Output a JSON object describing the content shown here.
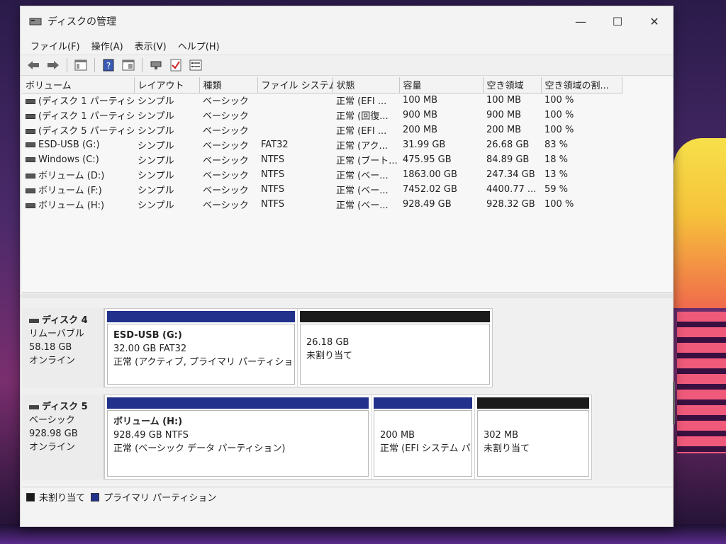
{
  "window": {
    "title": "ディスクの管理",
    "minimize": "—",
    "maximize": "☐",
    "close": "✕"
  },
  "menu": [
    "ファイル(F)",
    "操作(A)",
    "表示(V)",
    "ヘルプ(H)"
  ],
  "toolbar_icons": [
    "back-icon",
    "forward-icon",
    "console-tree-icon",
    "help-icon",
    "properties-icon",
    "connect-icon",
    "check-icon",
    "list-icon"
  ],
  "columns": [
    "ボリューム",
    "レイアウト",
    "種類",
    "ファイル システム",
    "状態",
    "容量",
    "空き領域",
    "空き領域の割..."
  ],
  "volumes": [
    [
      "(ディスク 1 パーティシ...",
      "シンプル",
      "ベーシック",
      "",
      "正常 (EFI ...",
      "100 MB",
      "100 MB",
      "100 %"
    ],
    [
      "(ディスク 1 パーティシ...",
      "シンプル",
      "ベーシック",
      "",
      "正常 (回復...",
      "900 MB",
      "900 MB",
      "100 %"
    ],
    [
      "(ディスク 5 パーティシ...",
      "シンプル",
      "ベーシック",
      "",
      "正常 (EFI ...",
      "200 MB",
      "200 MB",
      "100 %"
    ],
    [
      "ESD-USB (G:)",
      "シンプル",
      "ベーシック",
      "FAT32",
      "正常 (アク...",
      "31.99 GB",
      "26.68 GB",
      "83 %"
    ],
    [
      "Windows (C:)",
      "シンプル",
      "ベーシック",
      "NTFS",
      "正常 (ブート...",
      "475.95 GB",
      "84.89 GB",
      "18 %"
    ],
    [
      "ボリューム (D:)",
      "シンプル",
      "ベーシック",
      "NTFS",
      "正常 (ベー...",
      "1863.00 GB",
      "247.34 GB",
      "13 %"
    ],
    [
      "ボリューム (F:)",
      "シンプル",
      "ベーシック",
      "NTFS",
      "正常 (ベー...",
      "7452.02 GB",
      "4400.77 ...",
      "59 %"
    ],
    [
      "ボリューム (H:)",
      "シンプル",
      "ベーシック",
      "NTFS",
      "正常 (ベー...",
      "928.49 GB",
      "928.32 GB",
      "100 %"
    ]
  ],
  "disk4": {
    "name": "ディスク 4",
    "type": "リムーバブル",
    "size": "58.18 GB",
    "status": "オンライン",
    "partitions": [
      {
        "title": "ESD-USB (G:)",
        "line1": "32.00 GB FAT32",
        "line2": "正常 (アクティブ, プライマリ パーティション)"
      },
      {
        "title": "",
        "line1": "26.18 GB",
        "line2": "未割り当て"
      }
    ]
  },
  "disk5": {
    "name": "ディスク 5",
    "type": "ベーシック",
    "size": "928.98 GB",
    "status": "オンライン",
    "partitions": [
      {
        "title": "ボリューム (H:)",
        "line1": "928.49 GB NTFS",
        "line2": "正常 (ベーシック データ パーティション)"
      },
      {
        "title": "",
        "line1": "200 MB",
        "line2": "正常 (EFI システム パ"
      },
      {
        "title": "",
        "line1": "302 MB",
        "line2": "未割り当て"
      }
    ]
  },
  "legend": {
    "unallocated": "未割り当て",
    "primary": "プライマリ パーティション"
  },
  "colors": {
    "primary": "#22318c",
    "unallocated": "#1b1b1b"
  }
}
